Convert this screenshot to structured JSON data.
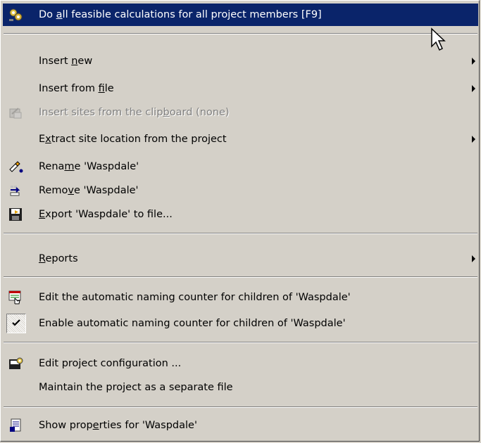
{
  "menu": {
    "items": [
      {
        "label_pre": "Do ",
        "label_accel": "a",
        "label_post": "ll feasible calculations for all project members [F9]",
        "icon": "calculate-gears-icon"
      },
      {
        "label_pre": "Insert ",
        "label_accel": "n",
        "label_post": "ew",
        "submenu": true
      },
      {
        "label_pre": "Insert from ",
        "label_accel": "f",
        "label_post": "ile",
        "submenu": true
      },
      {
        "label_pre": "Insert sites from the clip",
        "label_accel": "b",
        "label_post": "oard (none)",
        "icon": "clipboard-sites-icon",
        "disabled": true
      },
      {
        "label_pre": "E",
        "label_accel": "x",
        "label_post": "tract site location from the project",
        "submenu": true
      },
      {
        "label_pre": "Rena",
        "label_accel": "m",
        "label_post": "e 'Waspdale'",
        "icon": "rename-pencil-icon"
      },
      {
        "label_pre": "Remo",
        "label_accel": "v",
        "label_post": "e 'Waspdale'",
        "icon": "remove-icon"
      },
      {
        "label_pre": "",
        "label_accel": "E",
        "label_post": "xport 'Waspdale' to file...",
        "icon": "export-disk-icon"
      },
      {
        "label_pre": "",
        "label_accel": "R",
        "label_post": "eports",
        "submenu": true
      },
      {
        "label": "Edit the automatic naming counter for children of 'Waspdale'",
        "icon": "naming-counter-icon"
      },
      {
        "label": "Enable automatic naming counter for children of 'Waspdale'",
        "checked": true,
        "icon": "checkmark-icon"
      },
      {
        "label": "Edit project configuration ...",
        "icon": "project-config-icon"
      },
      {
        "label": "Maintain the project as a separate file"
      },
      {
        "label_pre": "Show prop",
        "label_accel": "e",
        "label_post": "rties for 'Waspdale'",
        "icon": "properties-icon"
      }
    ]
  },
  "colors": {
    "menu_bg": "#d4d0c8",
    "highlight_bg": "#0a246a",
    "highlight_text": "#ffffff",
    "disabled_text": "#808080"
  }
}
